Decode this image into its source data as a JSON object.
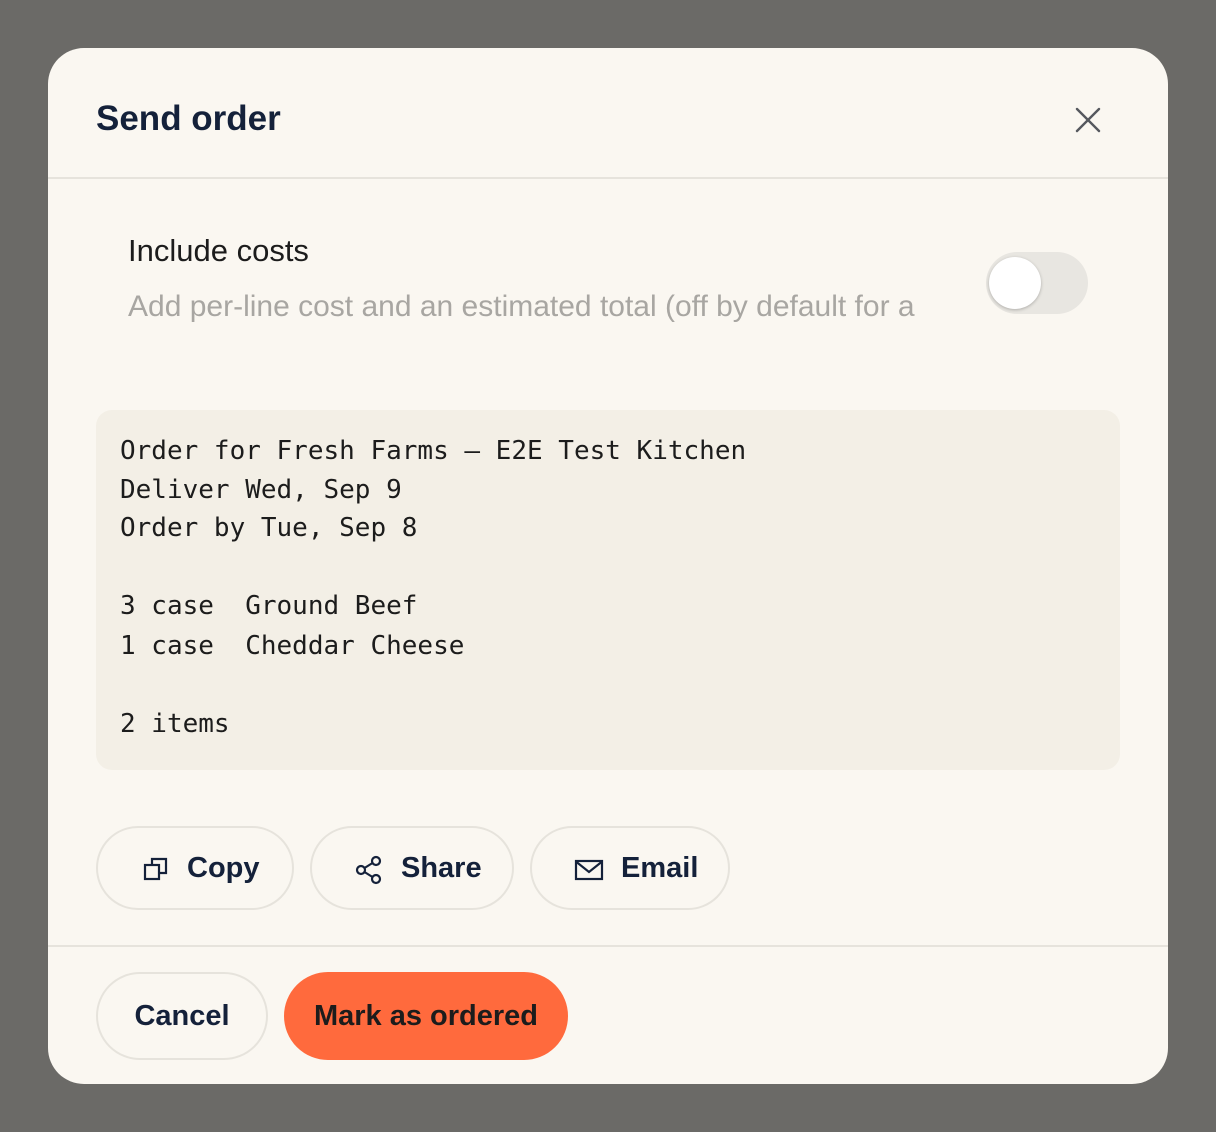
{
  "dialog": {
    "title": "Send order",
    "close_icon": "close-icon"
  },
  "include_costs": {
    "label": "Include costs",
    "description": "Add per-line cost and an estimated total (off by default for a",
    "enabled": false
  },
  "preview": {
    "lines": [
      "Order for Fresh Farms — E2E Test Kitchen",
      "Deliver Wed, Sep 9",
      "Order by Tue, Sep 8",
      "",
      "3 case  Ground Beef",
      "1 case  Cheddar Cheese",
      "",
      "2 items"
    ]
  },
  "actions": {
    "copy": {
      "label": "Copy",
      "icon": "copy-icon"
    },
    "share": {
      "label": "Share",
      "icon": "share-icon"
    },
    "email": {
      "label": "Email",
      "icon": "mail-icon"
    }
  },
  "footer": {
    "cancel_label": "Cancel",
    "primary_label": "Mark as ordered"
  },
  "colors": {
    "backdrop": "#6b6a67",
    "surface": "#faf7f1",
    "preview_bg": "#f3efe6",
    "accent": "#ff6a3d",
    "text_dark": "#14213a"
  }
}
